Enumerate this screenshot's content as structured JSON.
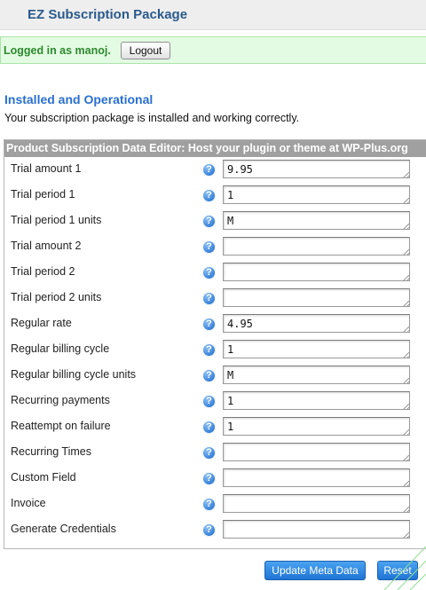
{
  "header": {
    "title": "EZ Subscription Package"
  },
  "login": {
    "text": "Logged in as manoj.",
    "logout_label": "Logout"
  },
  "status": {
    "title": "Installed and Operational",
    "description": "Your subscription package is installed and working correctly."
  },
  "editor": {
    "header": "Product Subscription Data Editor: Host your plugin or theme at WP-Plus.org",
    "help_icon": "question-mark-icon",
    "fields": [
      {
        "label": "Trial amount 1",
        "value": "9.95"
      },
      {
        "label": "Trial period 1",
        "value": "1"
      },
      {
        "label": "Trial period 1 units",
        "value": "M"
      },
      {
        "label": "Trial amount 2",
        "value": ""
      },
      {
        "label": "Trial period 2",
        "value": ""
      },
      {
        "label": "Trial period 2 units",
        "value": ""
      },
      {
        "label": "Regular rate",
        "value": "4.95"
      },
      {
        "label": "Regular billing cycle",
        "value": "1"
      },
      {
        "label": "Regular billing cycle units",
        "value": "M"
      },
      {
        "label": "Recurring payments",
        "value": "1"
      },
      {
        "label": "Reattempt on failure",
        "value": "1"
      },
      {
        "label": "Recurring Times",
        "value": ""
      },
      {
        "label": "Custom Field",
        "value": ""
      },
      {
        "label": "Invoice",
        "value": ""
      },
      {
        "label": "Generate Credentials",
        "value": ""
      }
    ]
  },
  "actions": {
    "update_label": "Update Meta Data",
    "reset_label": "Reset"
  },
  "colors": {
    "title_blue": "#2a5a8c",
    "section_blue": "#2a6fd0",
    "login_green": "#2d8a2d",
    "login_bg": "#e3fbe3",
    "button_blue": "#1f74d4"
  }
}
